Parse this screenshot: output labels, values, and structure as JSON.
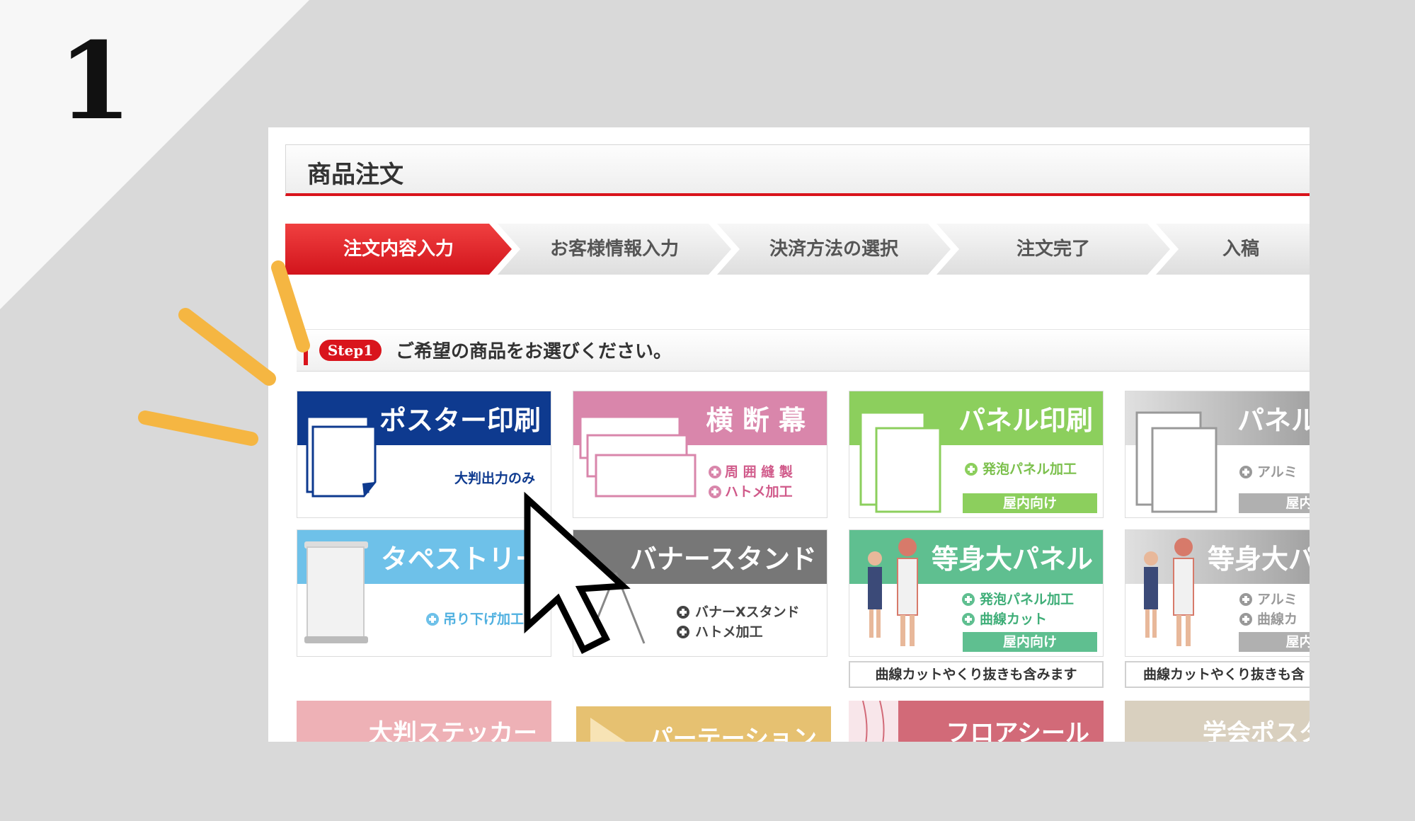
{
  "step_number": "1",
  "page_title": "商品注文",
  "progress_steps": [
    {
      "label": "注文内容入力",
      "active": true
    },
    {
      "label": "お客様情報入力",
      "active": false
    },
    {
      "label": "決済方法の選択",
      "active": false
    },
    {
      "label": "注文完了",
      "active": false
    },
    {
      "label": "入稿",
      "active": false
    }
  ],
  "step_badge": "Step1",
  "step_message": "ご希望の商品をお選びください。",
  "products": {
    "poster": {
      "title": "ポスター印刷",
      "sub": "大判出力のみ",
      "color": "#0e3a8f"
    },
    "banner": {
      "title": "横 断 幕",
      "options": [
        "周 囲 縫 製",
        "ハトメ加工"
      ],
      "color": "#d986ab"
    },
    "panel": {
      "title": "パネル印刷",
      "options": [
        "発泡パネル加工"
      ],
      "tag": "屋内向け",
      "color": "#8ccf5d"
    },
    "panel_alu": {
      "title": "パネル",
      "options": [
        "アルミ"
      ],
      "tag": "屋内・",
      "color": "#9a9a9a"
    },
    "tapestry": {
      "title": "タペストリー",
      "options": [
        "吊り下げ加工"
      ],
      "color": "#6ec1e9"
    },
    "banner_stand": {
      "title": "バナースタンド",
      "options": [
        "バナーXスタンド",
        "ハトメ加工"
      ],
      "color": "#777777"
    },
    "lifesize": {
      "title": "等身大パネル",
      "options": [
        "発泡パネル加工",
        "曲線カット"
      ],
      "tag": "屋内向け",
      "note": "曲線カットやくり抜きも含みます",
      "color": "#5fbf90"
    },
    "lifesize_alu": {
      "title": "等身大パ",
      "options": [
        "アルミ",
        "曲線カ"
      ],
      "tag": "屋内・",
      "note": "曲線カットやくり抜きも含",
      "color": "#9a9a9a"
    }
  },
  "bottom_row": [
    {
      "title": "大判ステッカー",
      "color": "#eeb1b6"
    },
    {
      "title": "パーテーション",
      "color": "#e6c171"
    },
    {
      "title": "フロアシール",
      "color": "#d26a78"
    },
    {
      "title": "学会ポスタ",
      "color": "#d9d0bf"
    }
  ]
}
